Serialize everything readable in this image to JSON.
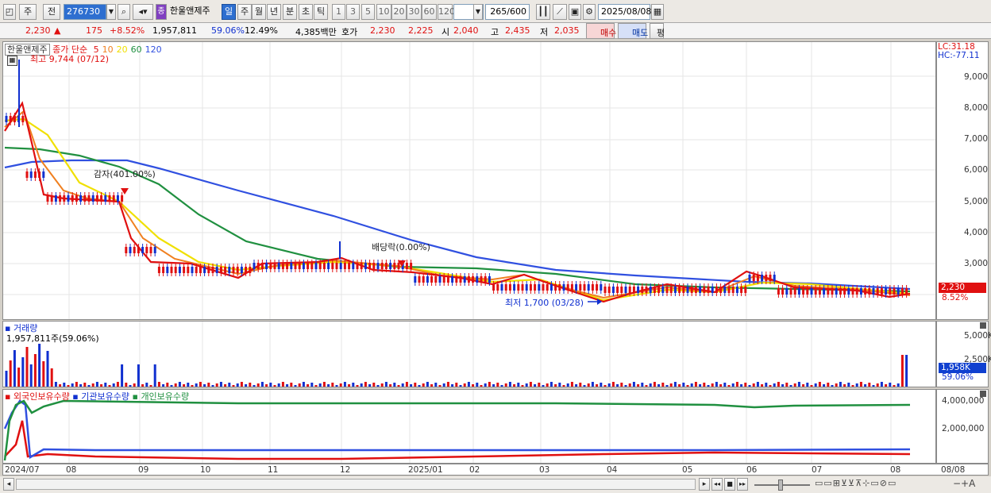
{
  "toolbar": {
    "period_mode": "주",
    "prev_label": "전",
    "code": "276730",
    "stock_name": "한울앤제주",
    "periods": [
      "일",
      "주",
      "월",
      "년",
      "분",
      "초",
      "틱"
    ],
    "selected_period": "일",
    "intervals": [
      "1",
      "3",
      "5",
      "10",
      "20",
      "30",
      "60",
      "120"
    ],
    "count": "265",
    "count_total": "/600",
    "date": "2025/08/08",
    "stock_badge": "종"
  },
  "quote": {
    "price": "2,230",
    "arrow": "▲",
    "change": "175",
    "change_pct": "+8.52%",
    "volume": "1,957,811",
    "volume_ratio": "59.06%",
    "turnover": "12.49%",
    "amount": "4,385백만",
    "bid_label": "호가",
    "ask": "2,230",
    "bid": "2,225",
    "open_label": "시",
    "open": "2,040",
    "high_label": "고",
    "high": "2,435",
    "low_label": "저",
    "low": "2,035",
    "buy_btn": "매수",
    "sell_btn": "매도",
    "eval_btn": "평"
  },
  "price_pane": {
    "legend_name": "한울앤제주",
    "legend_ma": "종가 단순",
    "ma_periods": [
      "5",
      "10",
      "20",
      "60",
      "120"
    ],
    "ma_colors": [
      "#e01010",
      "#f08020",
      "#f0e000",
      "#209040",
      "#3050e0"
    ],
    "max_note": "최고 9,744 (07/12)",
    "min_note": "최저 1,700 (03/28)",
    "event1": "감자(401.00%)",
    "event2": "배당락(0.00%)",
    "lc": "LC:31.18",
    "hc": "HC:-77.11",
    "ticks": [
      "9,000",
      "8,000",
      "7,000",
      "6,000",
      "5,000",
      "4,000",
      "3,000"
    ],
    "current_price": "2,230",
    "current_pct": "8.52%"
  },
  "volume_pane": {
    "title": "거래량",
    "value": "1,957,811주(59.06%)",
    "ticks": [
      "5,000K",
      "2,500K"
    ],
    "current": "1,958K",
    "current_pct": "59.06%"
  },
  "holdings_pane": {
    "legend": [
      "외국인보유수량",
      "기관보유수량",
      "개인보유수량"
    ],
    "ticks": [
      "4,000,000",
      "2,000,000"
    ]
  },
  "x_axis": [
    "2024/07",
    "08",
    "09",
    "10",
    "11",
    "12",
    "2025/01",
    "02",
    "03",
    "04",
    "05",
    "06",
    "07",
    "08",
    "08/08"
  ]
}
